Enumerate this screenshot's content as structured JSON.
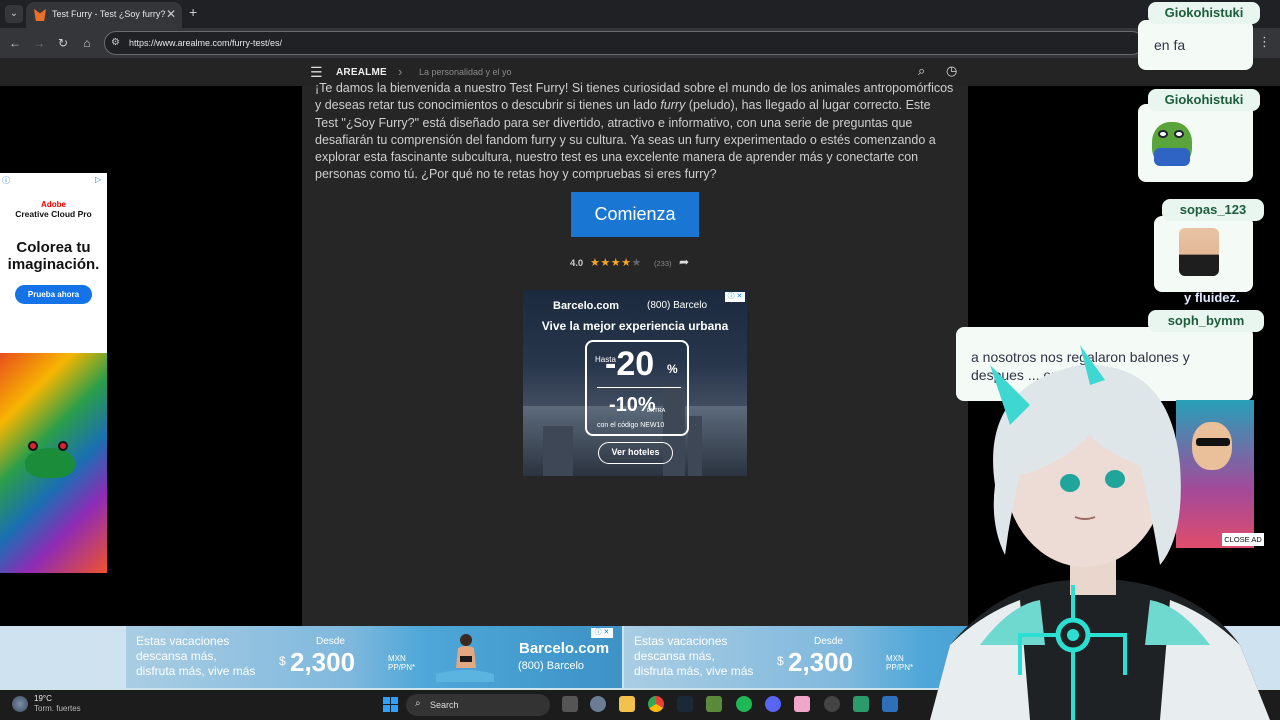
{
  "browser": {
    "tab_title": "Test Furry - Test ¿Soy furry?",
    "tab_close": "✕",
    "new_tab": "+",
    "url": "https://www.arealme.com/furry-test/es/"
  },
  "site": {
    "brand": "AREALME",
    "breadcrumb": "La personalidad y el yo"
  },
  "content": {
    "intro_part1": "¡Te damos la bienvenida a nuestro Test Furry! Si tienes curiosidad sobre el mundo de los animales antropomórficos y deseas retar tus conocimientos o descubrir si tienes un lado ",
    "intro_italic": "furry",
    "intro_part2": " (peludo), has llegado al lugar correcto. Este Test \"¿Soy Furry?\" está diseñado para ser divertido, atractivo e informativo, con una serie de preguntas que desafiarán tu comprensión del fandom furry y su cultura. Ya seas un furry experimentado o estés comenzando a explorar esta fascinante subcultura, nuestro test es una excelente manera de aprender más y conectarte con personas como tú. ¿Por qué no te retas hoy y compruebas si eres furry?",
    "cta_label": "Comienza",
    "rating_value": "4.0",
    "rating_stars": 4,
    "rating_count": "(233)"
  },
  "ad_middle": {
    "brand": "Barcelo.com",
    "phone": "(800) Barcelo",
    "headline": "Vive la mejor experiencia urbana",
    "hasta": "Hasta",
    "discount_main": "-20",
    "pct": "%",
    "discount_extra": "-10%",
    "extra_label": "EXTRA",
    "code_text": "con el código NEW10",
    "button": "Ver hoteles"
  },
  "ad_left": {
    "brand": "Adobe",
    "product": "Creative Cloud Pro",
    "headline": "Colorea tu imaginación.",
    "button": "Prueba ahora"
  },
  "ad_bottom": {
    "line1": "Estas vacaciones",
    "line2": "descansa más,",
    "line3": "disfruta más, vive más",
    "desde": "Desde",
    "currency": "$",
    "price": "2,300",
    "mxn": "MXN",
    "per": "PP/PN*",
    "brand": "Barcelo.com",
    "phone": "(800) Barcelo"
  },
  "taskbar": {
    "temp": "19°C",
    "weather": "Torm. fuertes",
    "search": "Search"
  },
  "chat": [
    {
      "user": "Giokohistuki",
      "message": "en fa"
    },
    {
      "user": "Giokohistuki",
      "message": ""
    },
    {
      "user": "sopas_123",
      "message": ""
    },
    {
      "user": "soph_bymm",
      "message": "a nosotros nos regalaron balones y despues ... on"
    }
  ],
  "overlay": {
    "partial_text": "y fluidez.",
    "close_ad": "CLOSE AD"
  },
  "colors": {
    "cta": "#1976d2",
    "star": "#f5a623",
    "chat_name": "#1e5d3c"
  }
}
